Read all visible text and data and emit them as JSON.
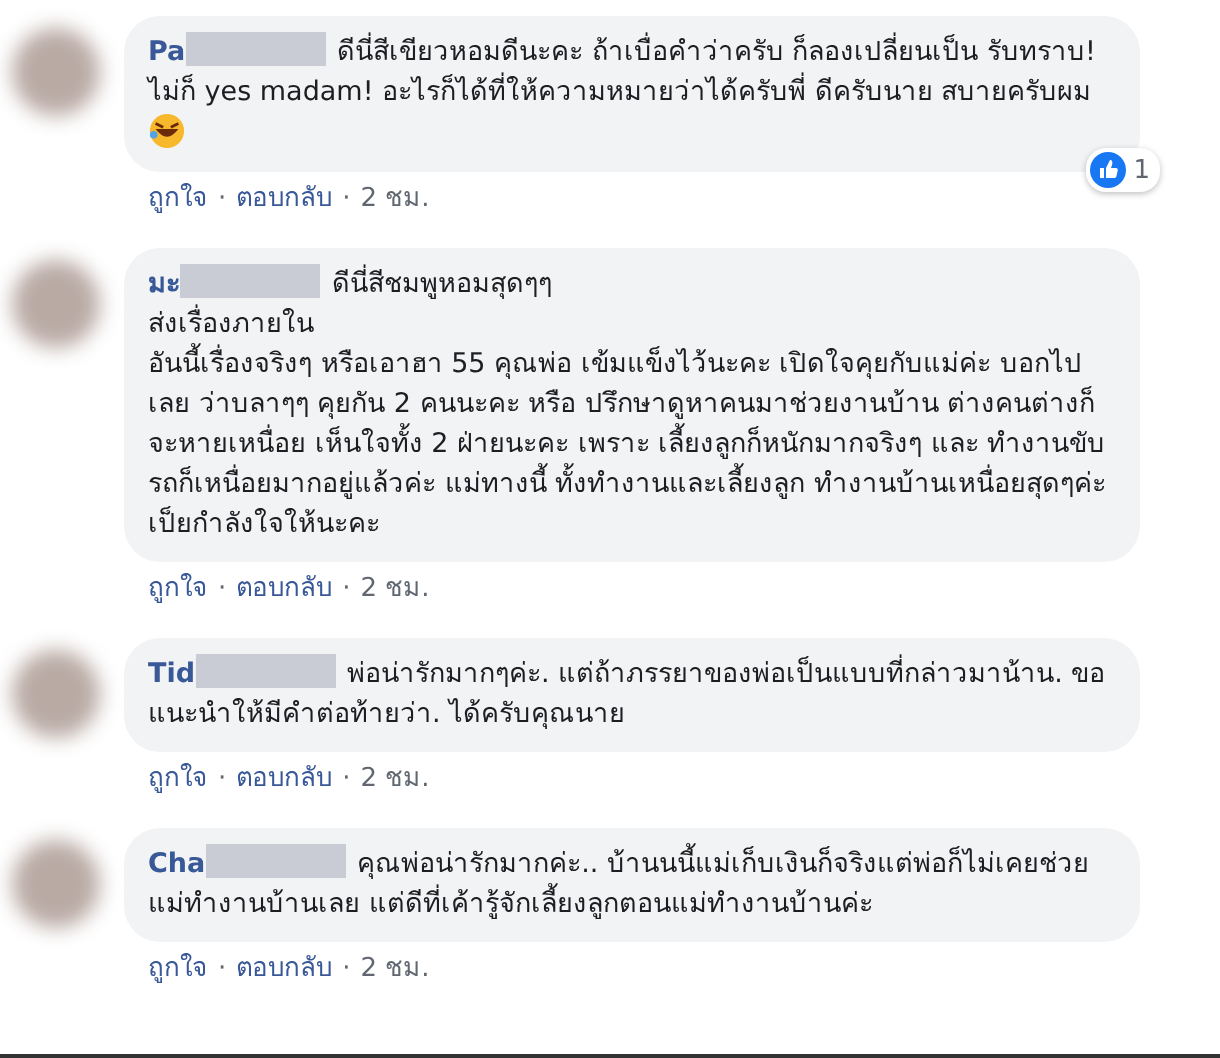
{
  "comments": [
    {
      "name": "Pa",
      "text": "ดีนี่สีเขียวหอมดีนะคะ ถ้าเบื่อคำว่าครับ ก็ลองเปลี่ยนเป็น รับทราบ! ไม่ก็ yes madam! อะไรก็ได้ที่ให้ความหมายว่าได้ครับพี่ ดีครับนาย สบายครับผม",
      "emoji": true,
      "reaction_count": "1",
      "actions": [
        {
          "kind": "link",
          "text": "ถูกใจ"
        },
        {
          "kind": "sep",
          "text": "·"
        },
        {
          "kind": "link",
          "text": "ตอบกลับ"
        },
        {
          "kind": "sep",
          "text": "·"
        },
        {
          "kind": "time",
          "text": "2 ชม."
        }
      ]
    },
    {
      "name": "มะ",
      "text": "ดีนี่สีชมพูหอมสุดๆๆ\nส่งเรื่องภายใน\nอันนี้เรื่องจริงๆ หรือเอาฮา 55 คุณพ่อ เข้มแข็งไว้นะคะ เปิดใจคุยกับแม่ค่ะ บอกไปเลย ว่าบลาๆๆ คุยกัน 2 คนนะคะ หรือ ปรึกษาดูหาคนมาช่วยงานบ้าน ต่างคนต่างก็จะหายเหนื่อย เห็นใจทั้ง 2 ฝ่ายนะคะ เพราะ เลี้ยงลูกก็หนักมากจริงๆ และ ทำงานขับรถก็เหนื่อยมากอยู่แล้วค่ะ แม่ทางนี้ ทั้งทำงานและเลี้ยงลูก ทำงานบ้านเหนื่อยสุดๆค่ะ เป็ยกำลังใจให้นะคะ",
      "actions": [
        {
          "kind": "link",
          "text": "ถูกใจ"
        },
        {
          "kind": "sep",
          "text": "·"
        },
        {
          "kind": "link",
          "text": "ตอบกลับ"
        },
        {
          "kind": "sep",
          "text": "·"
        },
        {
          "kind": "time",
          "text": "2 ชม."
        }
      ]
    },
    {
      "name": "Tid",
      "text": "พ่อน่ารักมากๆค่ะ. แต่ถ้าภรรยาของพ่อเป็นแบบที่กล่าวมาน้าน. ขอแนะนำให้มีคำต่อท้ายว่า. ได้ครับคุณนาย",
      "actions": [
        {
          "kind": "link",
          "text": "ถูกใจ"
        },
        {
          "kind": "sep",
          "text": "·"
        },
        {
          "kind": "link",
          "text": "ตอบกลับ"
        },
        {
          "kind": "sep",
          "text": "·"
        },
        {
          "kind": "time",
          "text": "2 ชม."
        }
      ]
    },
    {
      "name": "Cha",
      "text": "คุณพ่อน่ารักมากค่ะ.. บ้านนนี้แม่เก็บเงินก็จริงแต่พ่อก็ไม่เคยช่วยแม่ทำงานบ้านเลย แต่ดีที่เค้ารู้จักเลี้ยงลูกตอนแม่ทำงานบ้านค่ะ",
      "actions": [
        {
          "kind": "link",
          "text": "ถูกใจ"
        },
        {
          "kind": "sep",
          "text": "·"
        },
        {
          "kind": "link",
          "text": "ตอบกลับ"
        },
        {
          "kind": "sep",
          "text": "·"
        },
        {
          "kind": "time",
          "text": "2 ชม."
        }
      ]
    }
  ]
}
